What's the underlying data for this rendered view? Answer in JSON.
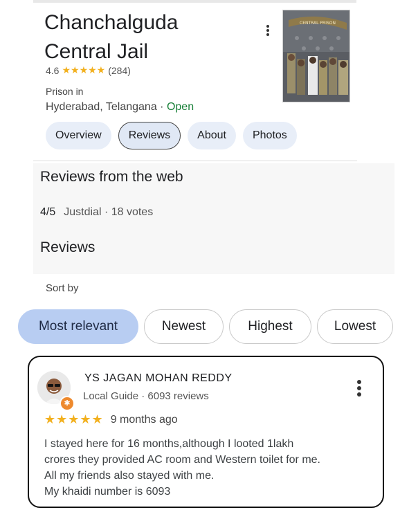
{
  "place": {
    "name_line1": "Chanchalguda",
    "name_line2": "Central Jail",
    "rating": "4.6",
    "stars": "★★★★★",
    "review_count": "(284)",
    "category": "Prison in",
    "location": "Hyderabad, Telangana",
    "separator": "·",
    "open_status": "Open",
    "photo_sign_text": "CENTRAL PRISON"
  },
  "tabs": [
    {
      "label": "Overview",
      "active": false
    },
    {
      "label": "Reviews",
      "active": true
    },
    {
      "label": "About",
      "active": false
    },
    {
      "label": "Photos",
      "active": false
    }
  ],
  "web_reviews": {
    "heading": "Reviews from the web",
    "score": "4/5",
    "source": "Justdial · 18 votes"
  },
  "reviews_section": {
    "heading": "Reviews",
    "sort_label": "Sort by",
    "sort_options": [
      {
        "label": "Most relevant",
        "selected": true
      },
      {
        "label": "Newest",
        "selected": false
      },
      {
        "label": "Highest",
        "selected": false
      },
      {
        "label": "Lowest",
        "selected": false
      }
    ]
  },
  "review": {
    "author": "YS JAGAN MOHAN REDDY",
    "meta": "Local Guide · 6093 reviews",
    "stars": "★★★★★",
    "rating": 5,
    "time": "9 months ago",
    "text_lines": [
      "I stayed here for 16 months,although I looted 1lakh",
      "crores they provided AC room and Western toilet for me.",
      "All my friends also stayed with me.",
      "My khaidi number is 6093"
    ]
  },
  "colors": {
    "star": "#f2b01e",
    "open": "#188038",
    "selected_chip": "#b8cdf2",
    "tab_bg": "#e8eef8",
    "guide_badge": "#ee8a2e"
  },
  "icons": {
    "menu": "more-vert-icon",
    "badge": "local-guide-icon"
  }
}
